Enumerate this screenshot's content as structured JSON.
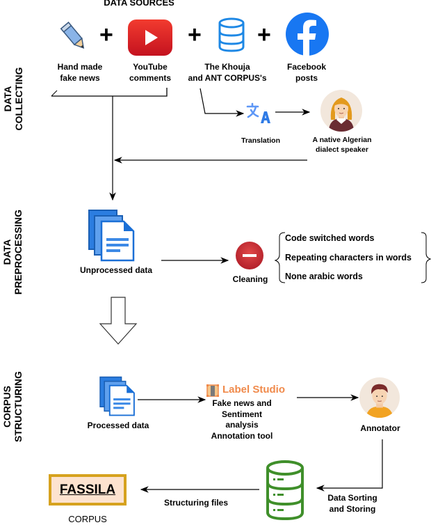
{
  "title": "DATA SOURCES",
  "stages": {
    "collecting": [
      "DATA",
      "COLLECTING"
    ],
    "preprocessing": [
      "DATA",
      "PREPROCESSING"
    ],
    "structuring": [
      "CORPUS",
      "STRUCTURING"
    ]
  },
  "sources": [
    {
      "icon": "pencil-icon",
      "lines": [
        "Hand made",
        "fake news"
      ]
    },
    {
      "icon": "youtube-icon",
      "lines": [
        "YouTube",
        "comments"
      ]
    },
    {
      "icon": "database-icon",
      "lines": [
        "The Khouja",
        "and ANT CORPUS's"
      ]
    },
    {
      "icon": "facebook-icon",
      "lines": [
        "Facebook",
        "posts"
      ]
    }
  ],
  "plus_sign": "+",
  "translation": {
    "label": "Translation"
  },
  "speaker": {
    "lines": [
      "A native Algerian",
      "dialect speaker"
    ]
  },
  "unprocessed": {
    "label": "Unprocessed data"
  },
  "cleaning": {
    "label": "Cleaning",
    "items": [
      "Code switched words",
      "Repeating characters in words",
      "None arabic words"
    ]
  },
  "processed": {
    "label": "Processed data"
  },
  "label_studio": {
    "brand": "Label Studio",
    "lines": [
      "Fake news and",
      "Sentiment",
      "analysis",
      "Annotation tool"
    ]
  },
  "annotator": {
    "label": "Annotator"
  },
  "storage": {
    "lines": [
      "Data Sorting",
      "and Storing"
    ]
  },
  "structuring_files": {
    "label": "Structuring files"
  },
  "corpus": {
    "name": "FASSILA",
    "caption": "CORPUS"
  },
  "colors": {
    "youtube_red": "#e62117",
    "facebook_blue": "#1877f2",
    "db_blue": "#1e88e5",
    "doc_blue": "#1976d2",
    "cleaning_red": "#c62828",
    "label_studio_orange": "#f08a4b",
    "storage_green": "#3f8f2a",
    "corpus_border": "#d6a21e",
    "corpus_fill": "#fde3cf"
  }
}
